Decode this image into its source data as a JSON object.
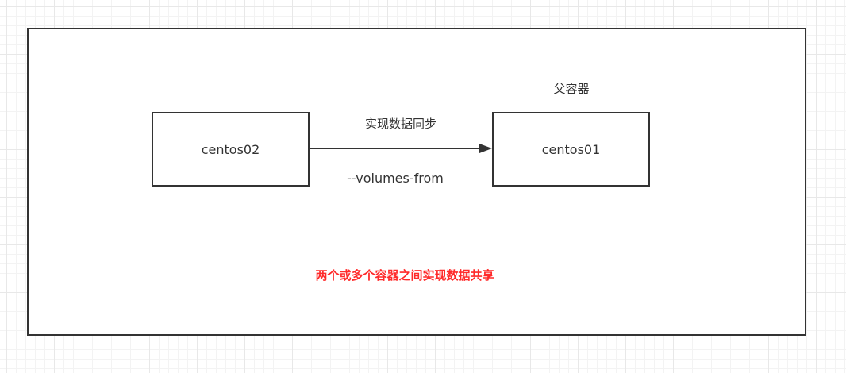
{
  "diagram": {
    "parent_label": "父容器",
    "child_node": "centos02",
    "parent_node": "centos01",
    "edge_top_label": "实现数据同步",
    "edge_bottom_label": "--volumes-from",
    "caption": "两个或多个容器之间实现数据共享",
    "caption_color": "#ff2a2a",
    "stroke_color": "#333333"
  }
}
